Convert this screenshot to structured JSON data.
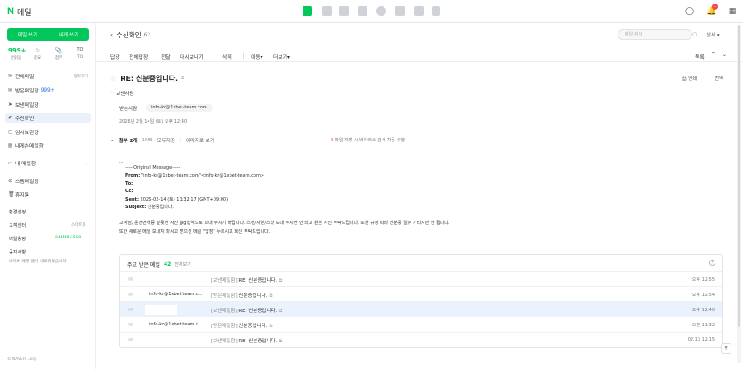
{
  "app": {
    "logo_letter": "N",
    "title": "메일"
  },
  "topbar": {
    "apps": [
      "mail-app-icon",
      "calendar-app-icon",
      "contacts-app-icon",
      "memo-app-icon",
      "settings-app-icon",
      "address-app-icon",
      "box-app-icon",
      "bookmark-app-icon"
    ],
    "notification_count": "1"
  },
  "sidebar": {
    "write_label": "메일 쓰기",
    "self_label": "내게 쓰기",
    "quick": [
      {
        "value": "999+",
        "label": "안읽음"
      },
      {
        "icon": "☆",
        "label": "중요"
      },
      {
        "icon": "📎",
        "label": "첨부"
      },
      {
        "icon": "TO",
        "label": "TO"
      }
    ],
    "items": [
      {
        "icon": "✉",
        "label": "전체메일",
        "aux": "정리하기"
      },
      {
        "icon": "✉",
        "label": "받은메일함",
        "count": "999+"
      },
      {
        "icon": "➤",
        "label": "보낸메일함"
      },
      {
        "icon": "✔",
        "label": "수신확인"
      },
      {
        "icon": "▢",
        "label": "임시보관함"
      },
      {
        "icon": "▤",
        "label": "내게쓴메일함"
      }
    ],
    "my_folder": "내 메일함",
    "spam": "스팸메일함",
    "trash": "휴지통",
    "settings": "환경설정",
    "support": "고객센터",
    "support_aux": "스마트봇",
    "capacity_label": "메일용량",
    "capacity_value": "244MB / 5GB",
    "notice": "공지사항",
    "notice_text": "네이버 메일 앱이 새로워졌습니다",
    "footer": "© NAVER Corp."
  },
  "content": {
    "breadcrumb": "수신확인",
    "breadcrumb_count": "62",
    "search_placeholder": "메일 검색",
    "detail_label": "상세",
    "toolbar": [
      "답장",
      "전체답장",
      "전달",
      "다시보내기",
      "삭제",
      "이동",
      "더보기"
    ],
    "toolbar_right": "목록",
    "subject": "RE: 신분증입니다.",
    "print_label": "인쇄",
    "translate_label": "번역",
    "from_label": "보낸사람",
    "to_label": "받는사람",
    "to_value": "info-kr@1xbet-team.com",
    "date": "2026년 2월 14일 (토) 오후 12:40",
    "attach_label": "첨부 2개",
    "attach_size": "1MB",
    "attach_save": "모두저장",
    "attach_view": "이미지로 보기",
    "attach_warning": "파일 저장 시 바이러스 검사 자동 수행"
  },
  "body": {
    "dots": "...",
    "orig": "-----Original Message-----",
    "from_key": "From:",
    "from_val": " \"info-kr@1xbet-team.com\"<info-kr@1xbet-team.com>",
    "to_key": "To:",
    "cc_key": "Cc:",
    "sent_key": "Sent:",
    "sent_val": " 2026-02-14 (토) 11:32:17 (GMT+09:00)",
    "subject_key": "Subject:",
    "subject_val": " 신분증입니다.",
    "para1": "고객님, 운전면허증 앞뒷면 사진 jpg형식으로 보내 주시기 바랍니다. 스캔/사본/스샷 보내 주시면 안 되고 원본 사진 부탁드립니다. 또한 규정 따라 신분증 일부 가리시면 안 됩니다.",
    "para2": "또한 새로운 메일 보내지 마시고 받으신 메일 \"답장\" 누르시고 회신 부탁드립니다."
  },
  "related": {
    "title": "주고 받은 메일",
    "count": "42",
    "view_all": "전체보기",
    "rows": [
      {
        "from": "",
        "folder": "[보낸메일함]",
        "subject": "RE: 신분증입니다.",
        "time": "오후 12:55"
      },
      {
        "from": "info-kr@1xbet-team.c...",
        "folder": "[받은메일함]",
        "subject": "신분증입니다.",
        "time": "오후 12:54"
      },
      {
        "from": "",
        "folder": "[보낸메일함]",
        "subject": "RE: 신분증입니다.",
        "time": "오후 12:40"
      },
      {
        "from": "info-kr@1xbet-team.c...",
        "folder": "[받은메일함]",
        "subject": "신분증입니다.",
        "time": "오전 11:32"
      },
      {
        "from": "",
        "folder": "[보낸메일함]",
        "subject": "RE: 신분증입니다.",
        "time": "02.13 12:15"
      }
    ]
  }
}
